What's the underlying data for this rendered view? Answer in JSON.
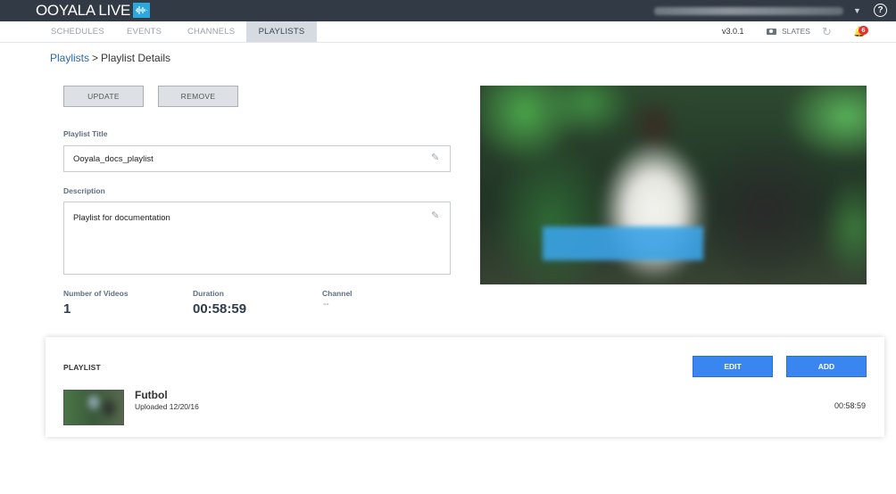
{
  "app": {
    "brand": "OOYALA LIVE"
  },
  "nav": {
    "tabs": [
      {
        "label": "SCHEDULES"
      },
      {
        "label": "EVENTS"
      },
      {
        "label": "CHANNELS"
      },
      {
        "label": "PLAYLISTS"
      }
    ],
    "version": "v3.0.1",
    "slates_label": "SLATES",
    "notifications_count": "6"
  },
  "breadcrumb": {
    "parent": "Playlists",
    "separator": ">",
    "current": "Playlist Details"
  },
  "actions": {
    "update_label": "UPDATE",
    "remove_label": "REMOVE"
  },
  "form": {
    "title_label": "Playlist Title",
    "title_value": "Ooyala_docs_playlist",
    "description_label": "Description",
    "description_value": "Playlist for documentation"
  },
  "stats": {
    "videos_label": "Number of Videos",
    "videos_value": "1",
    "duration_label": "Duration",
    "duration_value": "00:58:59",
    "channel_label": "Channel",
    "channel_value": "--"
  },
  "playlist": {
    "heading": "PLAYLIST",
    "edit_label": "EDIT",
    "add_label": "ADD",
    "items": [
      {
        "title": "Futbol",
        "uploaded": "Uploaded 12/20/16",
        "duration": "00:58:59"
      }
    ]
  },
  "colors": {
    "topbar": "#323a45",
    "accent_blue": "#3a86f0",
    "link": "#2867b2",
    "badge": "#e5302e"
  }
}
